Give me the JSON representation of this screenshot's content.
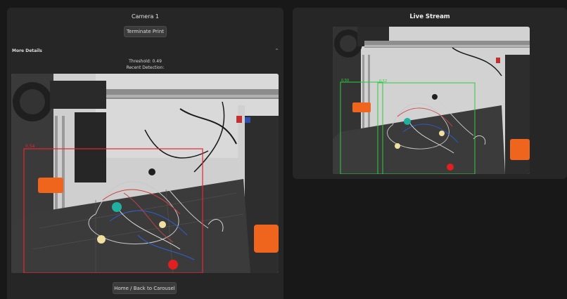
{
  "left_panel": {
    "title": "Camera 1",
    "terminate_label": "Terminate Print",
    "details_label": "More Details",
    "details_caret": "^",
    "threshold_text": "Threshold: 0.49",
    "recent_text": "Recent Detection:",
    "detection_image": {
      "box_color": "#e8262e",
      "box_label": "0.54"
    },
    "home_label": "Home / Back to Carousel"
  },
  "right_panel": {
    "title": "Live Stream",
    "live_image": {
      "box_color": "#2ecc40",
      "box_labels": [
        "0.50",
        "0.52"
      ]
    }
  },
  "colors": {
    "background": "#181818",
    "panel": "#262626",
    "button": "#3b3b3b",
    "printer_orange": "#f0651e"
  },
  "icons": [
    "chevron-up-icon"
  ]
}
